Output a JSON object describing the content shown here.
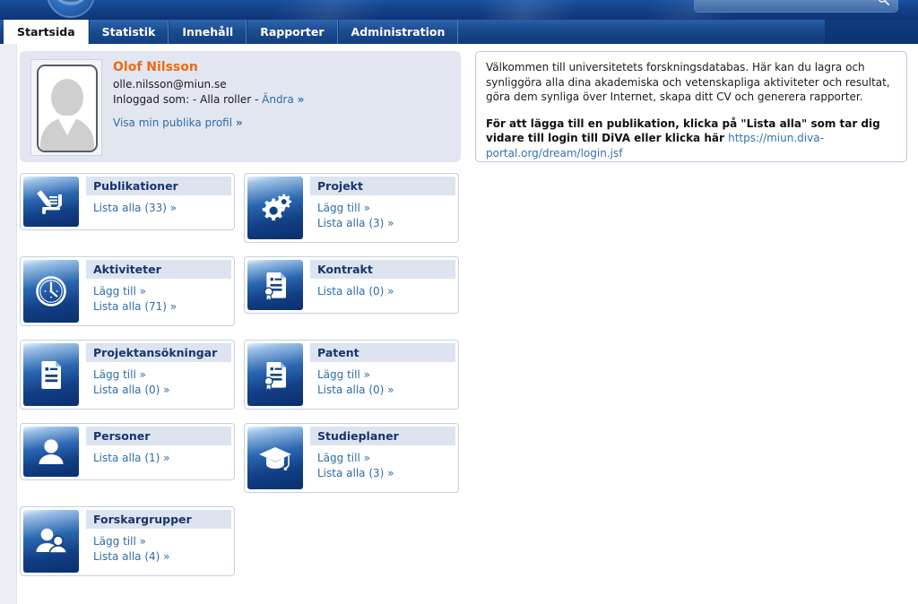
{
  "header": {
    "logo_icon": "university-seal-logo",
    "search": {
      "value": "",
      "placeholder": "",
      "icon": "search-icon"
    }
  },
  "tabs": [
    {
      "label": "Startsida",
      "active": true
    },
    {
      "label": "Statistik",
      "active": false
    },
    {
      "label": "Innehåll",
      "active": false
    },
    {
      "label": "Rapporter",
      "active": false
    },
    {
      "label": "Administration",
      "active": false
    }
  ],
  "profile": {
    "avatar_icon": "default-user-avatar",
    "name": "Olof Nilsson",
    "email": "olle.nilsson@miun.se",
    "role_prefix": "Inloggad som: - Alla roller - ",
    "role_change_label": "Ändra",
    "public_profile_label": "Visa min publika profil",
    "chevron": "»"
  },
  "welcome": {
    "paragraph": "Välkommen till universitetets forskningsdatabas. Här kan du lagra och synliggöra alla dina akademiska och vetenskapliga aktiviteter och resultat, göra dem synliga över Internet, skapa ditt CV och generera rapporter.",
    "bold_text": "För att lägga till en publikation, klicka på \"Lista alla\" som tar dig vidare till login till DiVA eller klicka här",
    "url": "https://miun.diva-portal.org/dream/login.jsf"
  },
  "cards": [
    {
      "title": "Publikationer",
      "icon": "publication-scroll-pen-icon",
      "links": [
        "Lista alla (33) »"
      ]
    },
    {
      "title": "Projekt",
      "icon": "gears-icon",
      "links": [
        "Lägg till »",
        "Lista alla (3) »"
      ]
    },
    {
      "title": "Aktiviteter",
      "icon": "clock-icon",
      "links": [
        "Lägg till »",
        "Lista alla (71) »"
      ]
    },
    {
      "title": "Kontrakt",
      "icon": "document-seal-icon",
      "links": [
        "Lista alla (0) »"
      ]
    },
    {
      "title": "Projektansökningar",
      "icon": "document-icon",
      "links": [
        "Lägg till »",
        "Lista alla (0) »"
      ]
    },
    {
      "title": "Patent",
      "icon": "document-seal-icon",
      "links": [
        "Lägg till »",
        "Lista alla (0) »"
      ]
    },
    {
      "title": "Personer",
      "icon": "person-icon",
      "links": [
        "Lista alla (1) »"
      ]
    },
    {
      "title": "Studieplaner",
      "icon": "graduation-cap-icon",
      "links": [
        "Lägg till »",
        "Lista alla (3) »"
      ]
    },
    {
      "title": "Forskargrupper",
      "icon": "two-people-icon",
      "links": [
        "Lägg till »",
        "Lista alla (4) »"
      ]
    }
  ],
  "colors": {
    "banner_blue": "#123f86",
    "accent_orange": "#ee6a11",
    "link_blue": "#2e6ca8",
    "card_title_bg": "#dde4f0",
    "card_title_text": "#17356e",
    "panel_grey": "#e2e6f1"
  }
}
